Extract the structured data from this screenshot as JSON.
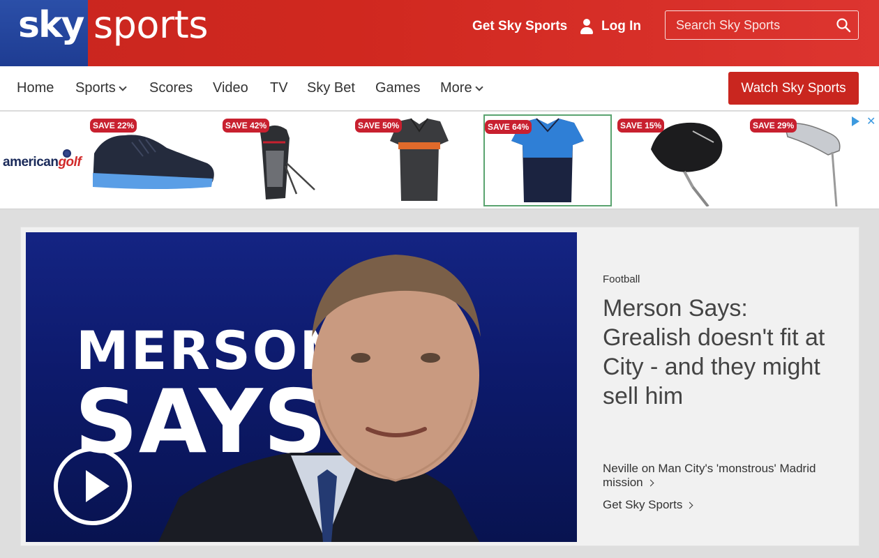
{
  "header": {
    "logo_sky": "sky",
    "logo_sports": "sports",
    "get_sky_sports": "Get Sky Sports",
    "login": "Log In",
    "search_placeholder": "Search Sky Sports",
    "icons": [
      "user-icon",
      "search-icon"
    ],
    "colors": {
      "brand_red": "#c9261f",
      "sky_blue": "#1e3c92"
    }
  },
  "nav": {
    "items": [
      {
        "label": "Home"
      },
      {
        "label": "Sports",
        "dropdown": true
      },
      {
        "label": "Scores"
      },
      {
        "label": "Video"
      },
      {
        "label": "TV"
      },
      {
        "label": "Sky Bet"
      },
      {
        "label": "Games"
      },
      {
        "label": "More",
        "dropdown": true
      }
    ],
    "watch_button": "Watch Sky Sports"
  },
  "ad": {
    "brand_a": "american",
    "brand_b": "golf",
    "products": [
      {
        "badge": "SAVE 22%",
        "icon": "golf-shoe-image"
      },
      {
        "badge": "SAVE 42%",
        "icon": "golf-bag-image"
      },
      {
        "badge": "SAVE 50%",
        "icon": "polo-shirt-image"
      },
      {
        "badge": "SAVE 64%",
        "icon": "polo-shirt-image"
      },
      {
        "badge": "SAVE 15%",
        "icon": "putter-image"
      },
      {
        "badge": "SAVE 29%",
        "icon": "iron-club-image"
      }
    ]
  },
  "hero": {
    "image_text_line1": "MERSON",
    "image_text_line2": "SAYS",
    "category": "Football",
    "headline": "Merson Says: Grealish doesn't fit at City - and they might sell him",
    "related_1": "Neville on Man City's 'monstrous' Madrid mission",
    "related_2": "Get Sky Sports"
  }
}
